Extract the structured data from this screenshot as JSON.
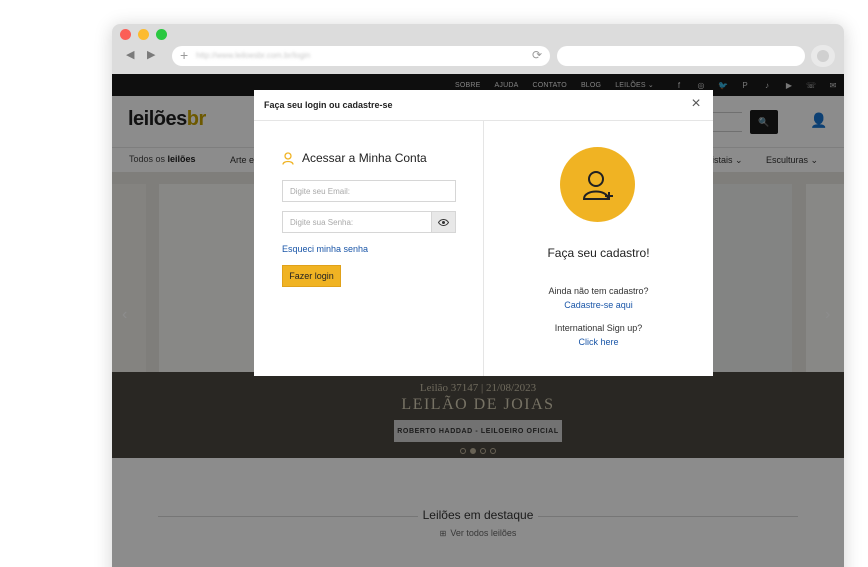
{
  "browser": {
    "url": "http://www.leiloesbr.com.br/login",
    "plus_glyph": "+",
    "reload_glyph": "⟳",
    "back_glyph": "◀",
    "forward_glyph": "▶"
  },
  "topbar": {
    "links": [
      "SOBRE",
      "AJUDA",
      "CONTATO",
      "BLOG",
      "LEILÕES ⌄"
    ],
    "social_icons": [
      "facebook-icon",
      "instagram-icon",
      "twitter-icon",
      "pinterest-icon",
      "tiktok-icon",
      "youtube-icon",
      "phone-icon",
      "mail-icon"
    ],
    "social_glyphs": [
      "f",
      "◎",
      "🐦",
      "P",
      "♪",
      "▶",
      "☏",
      "✉"
    ]
  },
  "header": {
    "logo_main": "leilões",
    "logo_accent": "br",
    "search_glyph": "🔍",
    "user_glyph": "👤"
  },
  "categories": {
    "all_prefix": "Todos os",
    "all_bold": "leilões",
    "first": "Arte e",
    "right_1": "ristais ⌄",
    "right_2": "Esculturas ⌄"
  },
  "hero": {
    "subtitle": "Leilão 37147 | 21/08/2023",
    "title": "LEILÃO DE JOIAS",
    "button_label": "ROBERTO HADDAD - LEILOEIRO OFICIAL",
    "prev_glyph": "‹",
    "next_glyph": "›",
    "slide_count": 4,
    "active_slide": 1
  },
  "featured": {
    "title": "Leilões em destaque",
    "link_icon": "⊞",
    "link_label": "Ver todos leilões"
  },
  "modal": {
    "title": "Faça seu login ou cadastre-se",
    "close_glyph": "×",
    "login_heading": "Acessar a Minha Conta",
    "email_placeholder": "Digite seu Email:",
    "password_placeholder": "Digite sua Senha:",
    "forgot_label": "Esqueci minha senha",
    "login_button": "Fazer login",
    "signup_title": "Faça seu cadastro!",
    "signup_question": "Ainda não tem cadastro?",
    "signup_link": "Cadastre-se aqui",
    "intl_question": "International Sign up?",
    "intl_link": "Click here"
  },
  "colors": {
    "accent": "#f0b323",
    "link": "#1a56a8",
    "topbar": "#1a1a1a"
  }
}
